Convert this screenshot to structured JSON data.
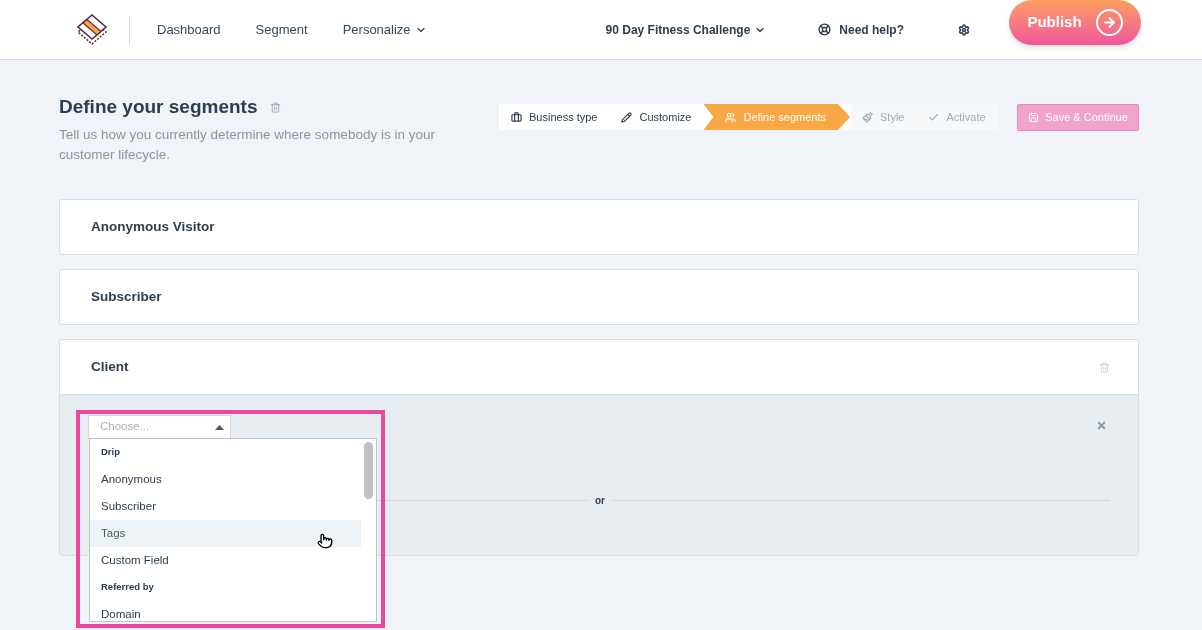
{
  "nav": {
    "items": [
      {
        "label": "Dashboard",
        "dropdown": false
      },
      {
        "label": "Segment",
        "dropdown": false
      },
      {
        "label": "Personalize",
        "dropdown": true
      }
    ],
    "project": "90 Day Fitness Challenge",
    "help": "Need help?",
    "publish": "Publish"
  },
  "header": {
    "title": "Define your segments",
    "description": "Tell us how you currently determine where somebody is in your customer lifecycle."
  },
  "steps": [
    {
      "label": "Business type",
      "selected": false,
      "completed": true
    },
    {
      "label": "Customize",
      "selected": false,
      "completed": true
    },
    {
      "label": "Define segments",
      "selected": true,
      "completed": false
    },
    {
      "label": "Style",
      "selected": false,
      "completed": false
    },
    {
      "label": "Activate",
      "selected": false,
      "completed": false
    }
  ],
  "save_button": {
    "label": "Save & Continue",
    "disabled": true
  },
  "segments": [
    {
      "name": "Anonymous Visitor",
      "expanded": false
    },
    {
      "name": "Subscriber",
      "expanded": false
    },
    {
      "name": "Client",
      "expanded": true
    }
  ],
  "condition": {
    "placeholder": "Choose...",
    "separator": "or",
    "dropdown": [
      {
        "kind": "group",
        "label": "Drip"
      },
      {
        "kind": "option",
        "label": "Anonymous",
        "highlighted": false
      },
      {
        "kind": "option",
        "label": "Subscriber",
        "highlighted": false
      },
      {
        "kind": "option",
        "label": "Tags",
        "highlighted": true
      },
      {
        "kind": "option",
        "label": "Custom Field",
        "highlighted": false
      },
      {
        "kind": "group",
        "label": "Referred by"
      },
      {
        "kind": "option",
        "label": "Domain",
        "highlighted": false
      }
    ]
  }
}
